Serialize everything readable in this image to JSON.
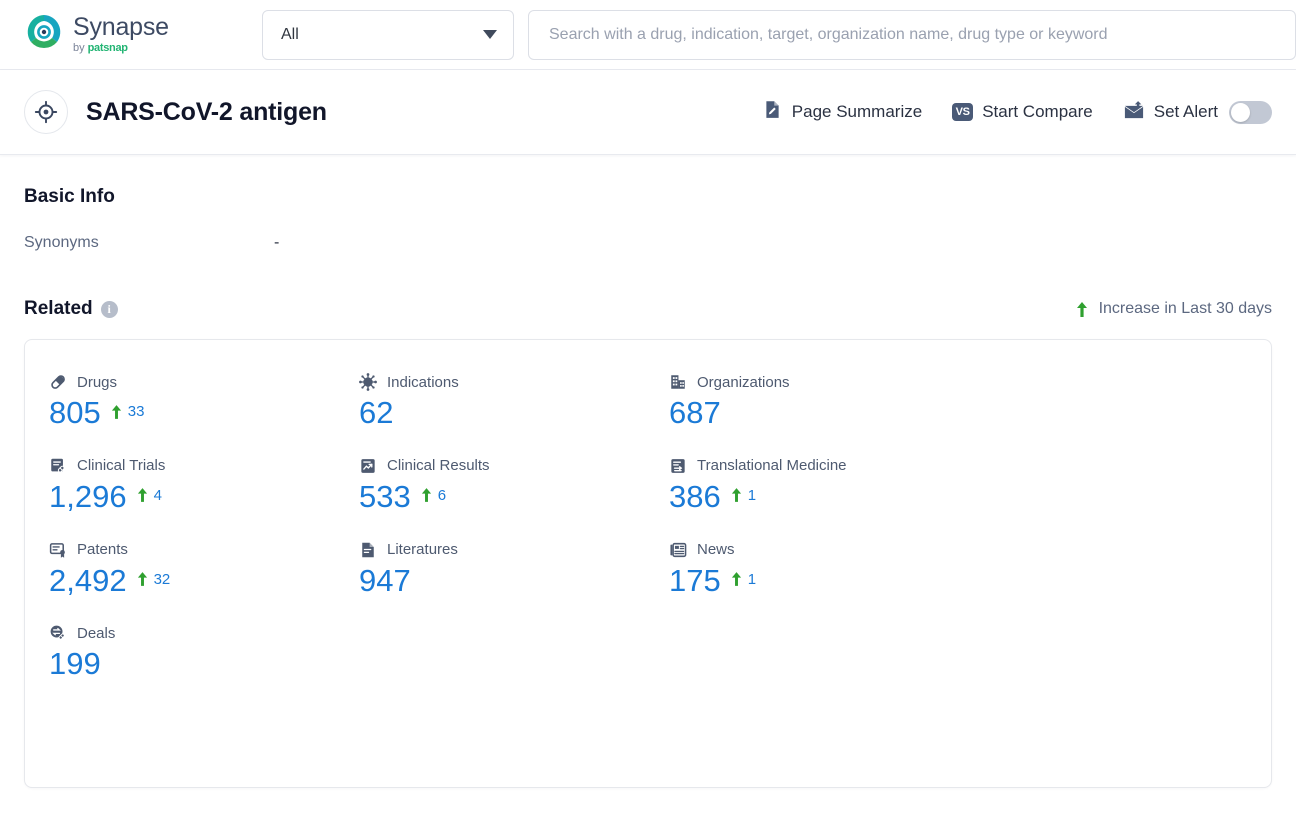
{
  "topbar": {
    "brand": {
      "name": "Synapse",
      "by": "by",
      "company": "patsnap",
      "logo_icon": "synapse-logo-icon"
    },
    "scope": {
      "value": "All",
      "caret_icon": "chevron-down-icon"
    },
    "search": {
      "value": "",
      "placeholder": "Search with a drug, indication, target, organization name, drug type or keyword"
    }
  },
  "titlebar": {
    "entity_icon": "target-icon",
    "title": "SARS-CoV-2 antigen",
    "actions": [
      {
        "label": "Page Summarize",
        "icon": "document-edit-icon"
      },
      {
        "label": "Start Compare",
        "icon": "vs-icon"
      },
      {
        "label": "Set Alert",
        "icon": "alert-mail-icon"
      }
    ],
    "alert_toggle": {
      "state": "off"
    }
  },
  "basic_info": {
    "heading": "Basic Info",
    "rows": [
      {
        "label": "Synonyms",
        "value": "-"
      }
    ]
  },
  "related": {
    "heading": "Related",
    "info_icon": "info-icon",
    "info_glyph": "i",
    "legend": {
      "arrow_icon": "arrow-up-icon",
      "label": "Increase in Last 30 days"
    },
    "stats": [
      {
        "icon": "pill-icon",
        "label": "Drugs",
        "value": "805",
        "delta": "33"
      },
      {
        "icon": "virus-icon",
        "label": "Indications",
        "value": "62",
        "delta": null
      },
      {
        "icon": "building-icon",
        "label": "Organizations",
        "value": "687",
        "delta": null
      },
      {
        "icon": "clinical-trial-icon",
        "label": "Clinical Trials",
        "value": "1,296",
        "delta": "4"
      },
      {
        "icon": "clinical-result-icon",
        "label": "Clinical Results",
        "value": "533",
        "delta": "6"
      },
      {
        "icon": "translational-medicine-icon",
        "label": "Translational Medicine",
        "value": "386",
        "delta": "1"
      },
      {
        "icon": "patent-icon",
        "label": "Patents",
        "value": "2,492",
        "delta": "32"
      },
      {
        "icon": "literature-icon",
        "label": "Literatures",
        "value": "947",
        "delta": null
      },
      {
        "icon": "news-icon",
        "label": "News",
        "value": "175",
        "delta": "1"
      },
      {
        "icon": "deal-icon",
        "label": "Deals",
        "value": "199",
        "delta": null
      }
    ]
  },
  "colors": {
    "accent_blue": "#1b7ad6",
    "increase_green": "#2fa02f",
    "icon_slate": "#4e5a70",
    "brand_green": "#22b473",
    "brand_teal": "#18a5c0"
  }
}
